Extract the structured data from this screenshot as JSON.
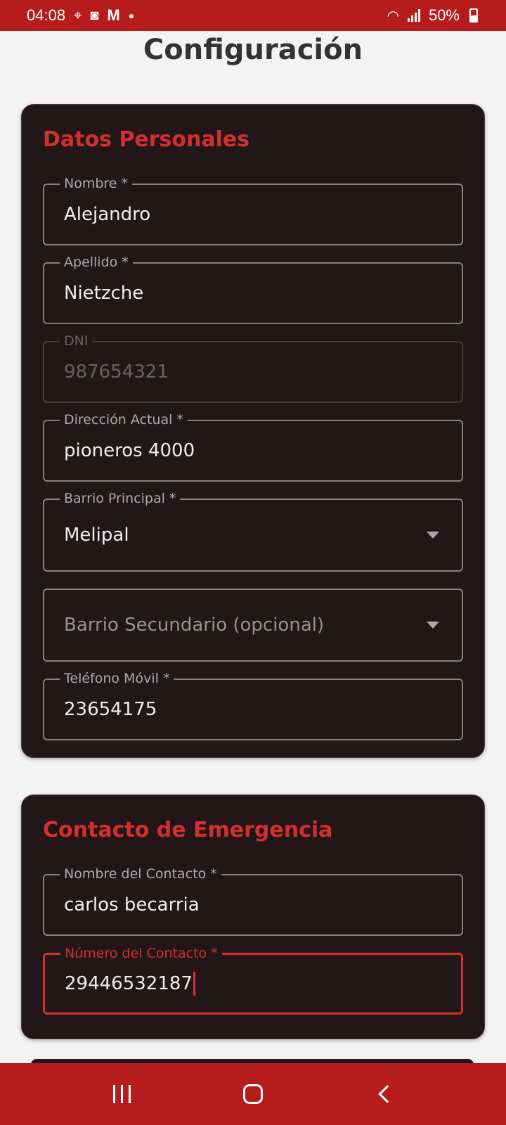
{
  "status_bar": {
    "time": "04:08",
    "battery": "50%",
    "icons": [
      "location-icon",
      "clock-app-icon",
      "gmail-icon",
      "dot-icon",
      "wifi-icon",
      "signal-icon",
      "battery-icon"
    ]
  },
  "page": {
    "title": "Configuración"
  },
  "personal": {
    "title": "Datos Personales",
    "nombre": {
      "label": "Nombre *",
      "value": "Alejandro"
    },
    "apellido": {
      "label": "Apellido *",
      "value": "Nietzche"
    },
    "dni": {
      "label": "DNI",
      "value": "987654321"
    },
    "direccion": {
      "label": "Dirección Actual *",
      "value": "pioneros 4000"
    },
    "barrio_principal": {
      "label": "Barrio Principal *",
      "value": "Melipal"
    },
    "barrio_secundario": {
      "placeholder": "Barrio Secundario (opcional)"
    },
    "telefono": {
      "label": "Teléfono Móvil *",
      "value": "23654175"
    }
  },
  "emergency": {
    "title": "Contacto de Emergencia",
    "nombre_contacto": {
      "label": "Nombre del Contacto *",
      "value": "carlos becarria"
    },
    "numero_contacto": {
      "label": "Número del Contacto *",
      "value": "29446532187"
    }
  },
  "colors": {
    "accent": "#b71c1c",
    "card_bg": "#231619",
    "title_red": "#d32f2f"
  }
}
